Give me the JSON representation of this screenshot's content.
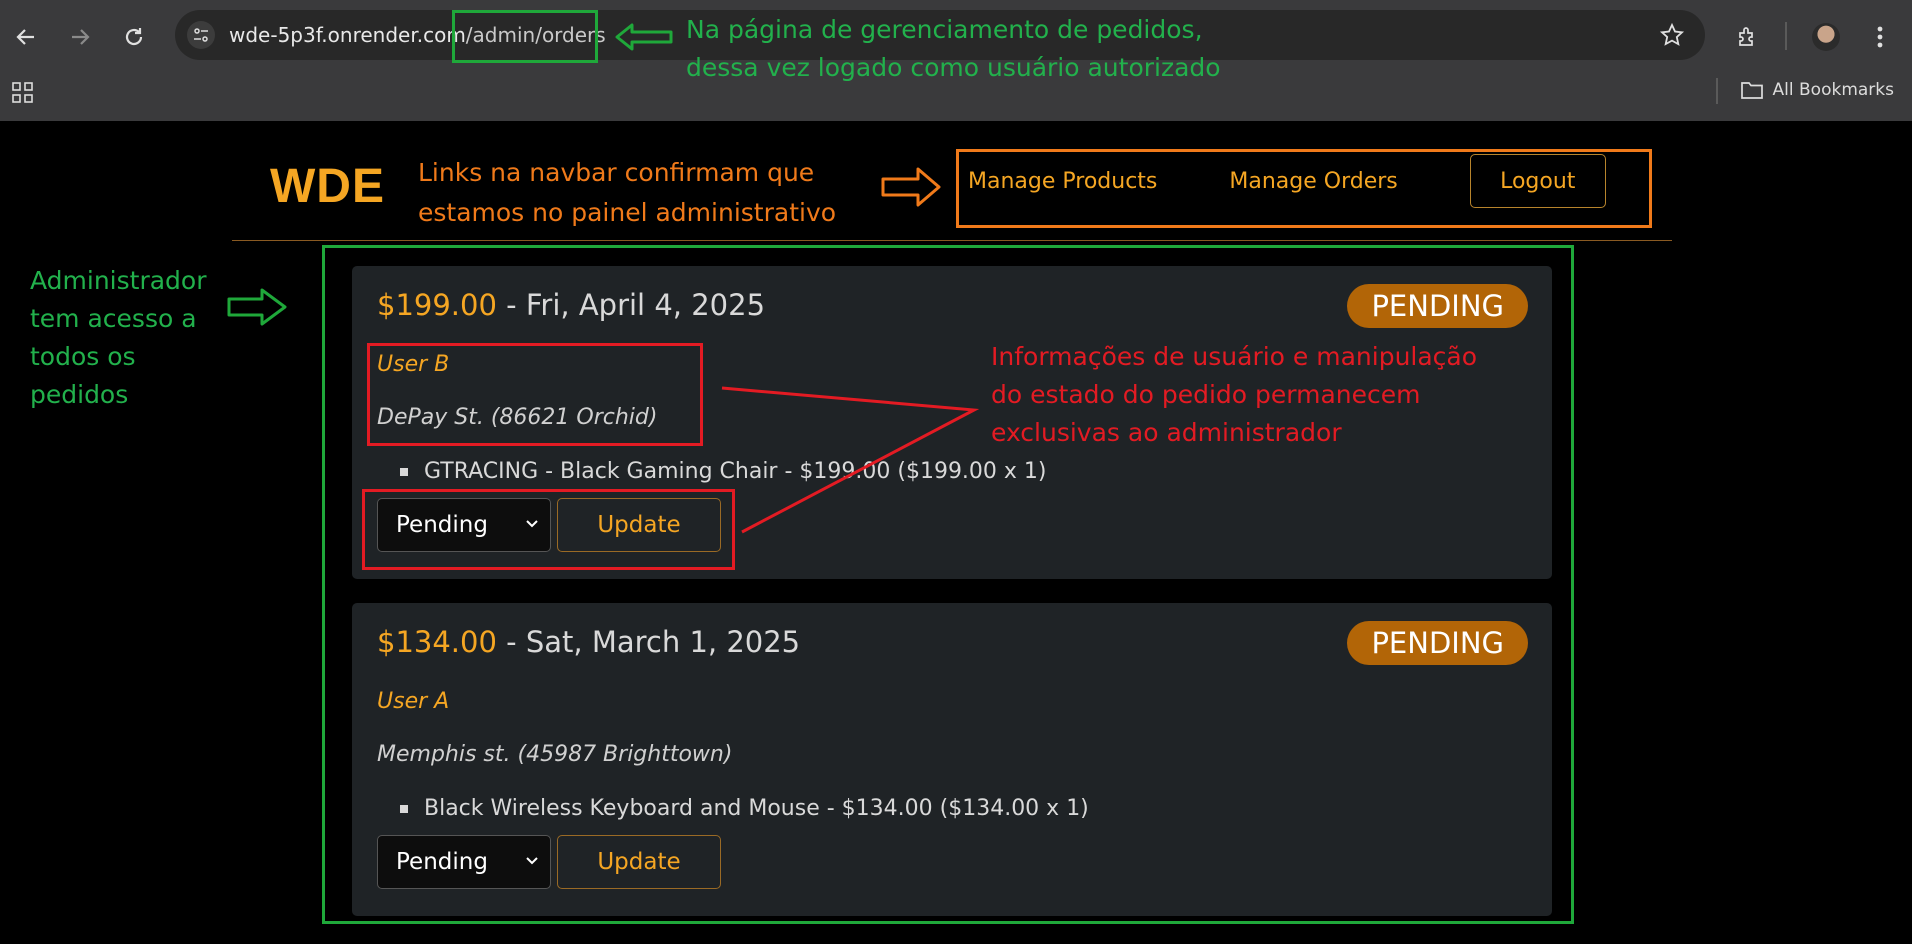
{
  "browser": {
    "url_host": "wde-5p3f.onrender.com",
    "url_path": "/admin/orders",
    "bookmarks_label": "All Bookmarks"
  },
  "navbar": {
    "logo": "WDE",
    "links": [
      "Manage Products",
      "Manage Orders"
    ],
    "logout_label": "Logout"
  },
  "orders": [
    {
      "price": "$199.00",
      "date": " - Fri, April 4, 2025",
      "status": "PENDING",
      "user": "User B",
      "address": "DePay St. (86621 Orchid)",
      "item": "GTRACING - Black Gaming Chair - $199.00 ($199.00 x 1)",
      "selected_status": "Pending",
      "update_label": "Update"
    },
    {
      "price": "$134.00",
      "date": " - Sat, March 1, 2025",
      "status": "PENDING",
      "user": "User A",
      "address": "Memphis st. (45987 Brighttown)",
      "item": "Black Wireless Keyboard and Mouse - $134.00 ($134.00 x 1)",
      "selected_status": "Pending",
      "update_label": "Update"
    }
  ],
  "annotations": {
    "url_note": [
      "Na página de gerenciamento de pedidos,",
      "dessa vez logado como usuário autorizado"
    ],
    "navbar_note": [
      "Links na navbar confirmam que",
      "estamos no painel administrativo"
    ],
    "admin_note": [
      "Administrador",
      "tem acesso a",
      "todos os",
      "pedidos"
    ],
    "privacy_note": [
      "Informações de usuário e manipulação",
      "do estado do pedido permanecem",
      "exclusivas ao administrador"
    ]
  },
  "colors": {
    "accent": "#f5a623",
    "badge": "#b26507",
    "card": "#1f2326",
    "annotation_green": "#22b14c",
    "annotation_orange": "#f07a1a",
    "annotation_red": "#e31b23"
  }
}
